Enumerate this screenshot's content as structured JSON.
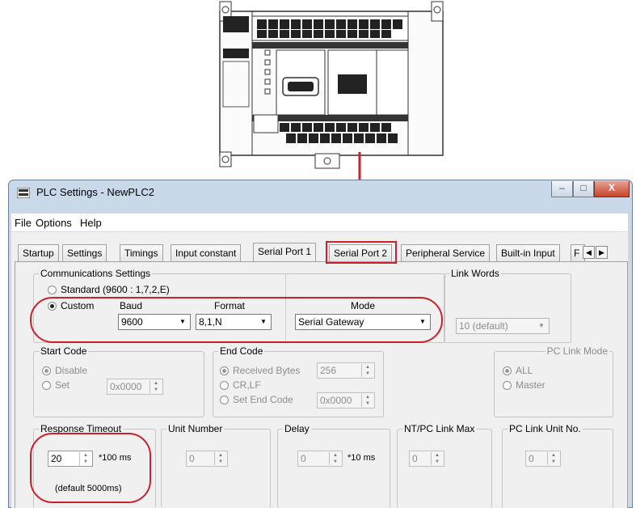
{
  "window": {
    "title": "PLC Settings - NewPLC2",
    "minimize": "–",
    "maximize": "□",
    "close": "X"
  },
  "menu": [
    "File",
    "Options",
    "Help"
  ],
  "tabs": [
    "Startup",
    "Settings",
    "Timings",
    "Input constant",
    "Serial Port 1",
    "Serial Port 2",
    "Peripheral Service",
    "Built-in Input",
    "F"
  ],
  "active_tab": "Serial Port 1",
  "comm": {
    "label": "Communications Settings",
    "standard": "Standard (9600 : 1,7,2,E)",
    "custom": "Custom",
    "baud_label": "Baud",
    "baud_value": "9600",
    "format_label": "Format",
    "format_value": "8,1,N",
    "mode_label": "Mode",
    "mode_value": "Serial Gateway"
  },
  "link_words": {
    "label": "Link Words",
    "value": "10 (default)"
  },
  "start_code": {
    "label": "Start Code",
    "disable": "Disable",
    "set": "Set",
    "value": "0x0000"
  },
  "end_code": {
    "label": "End Code",
    "received": "Received Bytes",
    "received_value": "256",
    "crlf": "CR,LF",
    "set_end": "Set End Code",
    "set_end_value": "0x0000"
  },
  "pc_link_mode": {
    "label": "PC Link Mode",
    "all": "ALL",
    "master": "Master"
  },
  "response_timeout": {
    "label": "Response Timeout",
    "value": "20",
    "unit": "*100 ms",
    "default": "(default 5000ms)"
  },
  "unit_number": {
    "label": "Unit Number",
    "value": "0"
  },
  "delay": {
    "label": "Delay",
    "value": "0",
    "unit": "*10 ms"
  },
  "nt_pc_link_max": {
    "label": "NT/PC Link Max",
    "value": "0"
  },
  "pc_link_unit_no": {
    "label": "PC Link Unit No.",
    "value": "0"
  },
  "colors": {
    "highlight": "#c8232c",
    "window_frame": "#c9d9ea"
  }
}
